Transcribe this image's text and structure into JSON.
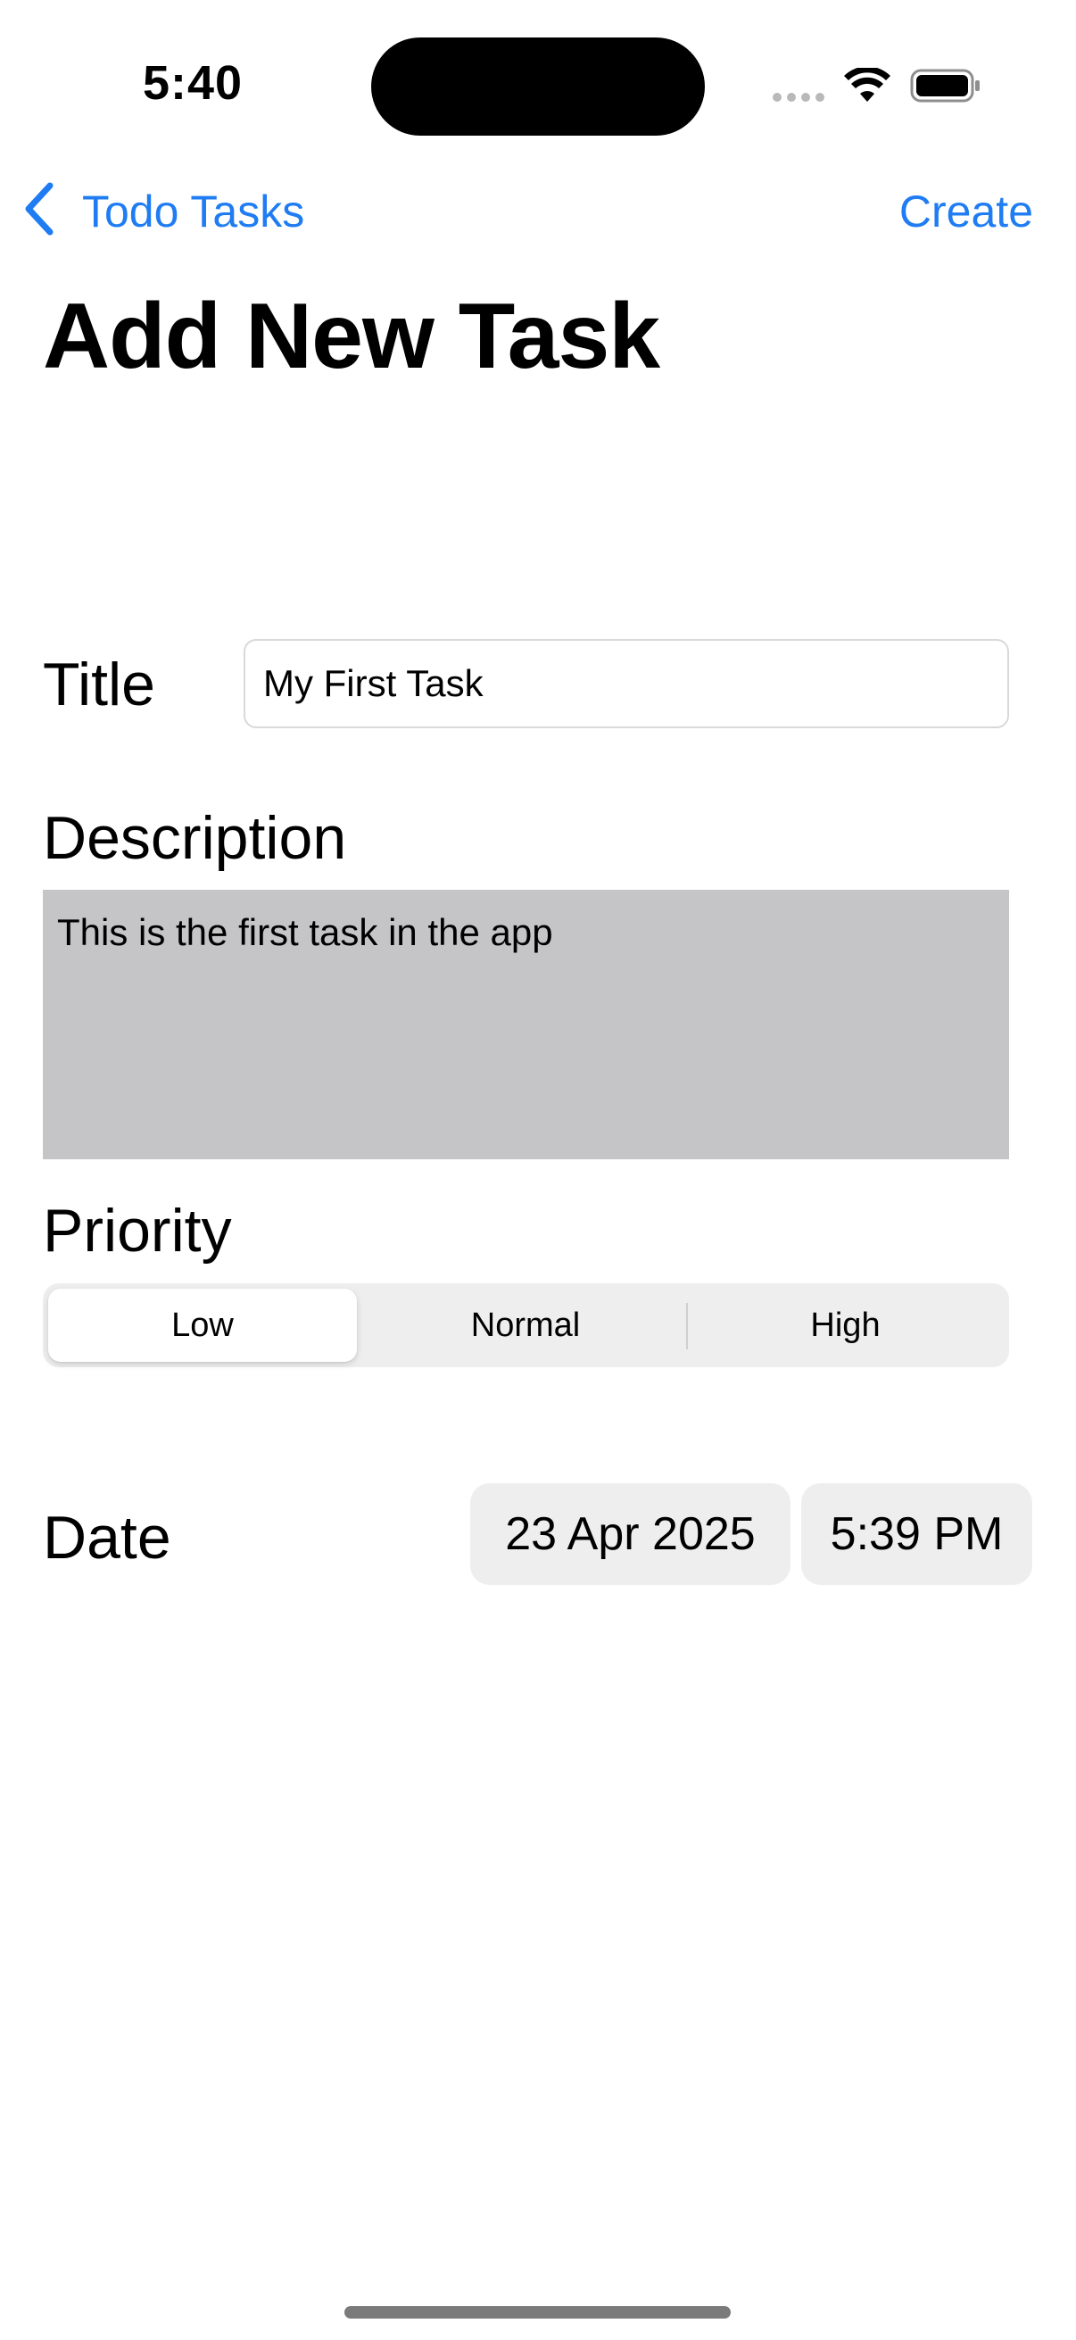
{
  "status_bar": {
    "time": "5:40"
  },
  "nav": {
    "back_label": "Todo Tasks",
    "action_label": "Create",
    "accent_color": "#1f7cf2"
  },
  "page": {
    "title": "Add New Task"
  },
  "form": {
    "title_label": "Title",
    "title_value": "My First Task",
    "description_label": "Description",
    "description_value": "This is the first task in the app",
    "priority_label": "Priority",
    "priority_options": [
      "Low",
      "Normal",
      "High"
    ],
    "priority_selected": "Low",
    "date_label": "Date",
    "date_value": "23 Apr 2025",
    "time_value": "5:39 PM"
  },
  "icons": {
    "back": "chevron-left-icon",
    "wifi": "wifi-icon",
    "battery": "battery-icon",
    "signal": "cellular-signal-icon"
  }
}
